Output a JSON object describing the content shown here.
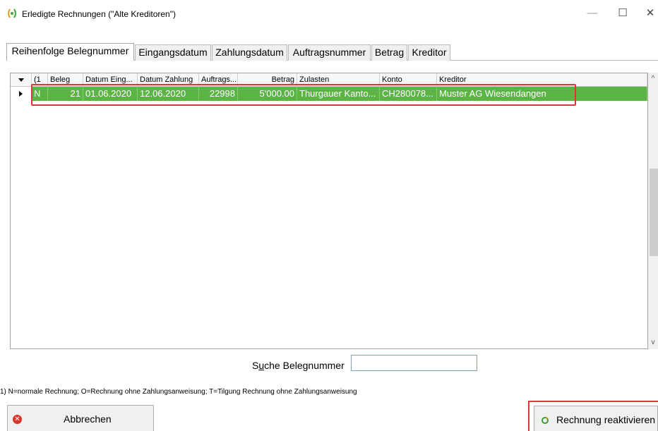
{
  "window": {
    "title": "Erledigte Rechnungen (\"Alte Kreditoren\")",
    "min_symbol": "—",
    "max_symbol": "☐",
    "close_symbol": "✕"
  },
  "tabs": [
    {
      "label": "Reihenfolge Belegnummer",
      "active": true
    },
    {
      "label": "Eingangsdatum",
      "active": false
    },
    {
      "label": "Zahlungsdatum",
      "active": false
    },
    {
      "label": "Auftragsnummer",
      "active": false
    },
    {
      "label": "Betrag",
      "active": false
    },
    {
      "label": "Kreditor",
      "active": false
    }
  ],
  "grid": {
    "columns": {
      "type": "(1",
      "beleg": "Beleg",
      "datum_eing": "Datum Eing...",
      "datum_zahlung": "Datum Zahlung",
      "auftrags": "Auftrags...",
      "betrag": "Betrag",
      "zulasten": "Zulasten",
      "konto": "Konto",
      "kreditor": "Kreditor"
    },
    "rows": [
      {
        "type": "N",
        "beleg": "21",
        "datum_eing": "01.06.2020",
        "datum_zahlung": "12.06.2020",
        "auftrags": "22998",
        "betrag": "5'000.00",
        "zulasten": "Thurgauer Kanto...",
        "konto": "CH280078...",
        "kreditor": "Muster AG Wiesendangen"
      }
    ]
  },
  "scrollbar": {
    "up": "^",
    "down": "v"
  },
  "search": {
    "label_prefix": "S",
    "label_underlined": "u",
    "label_suffix": "che Belegnummer",
    "value": ""
  },
  "footnote": "1) N=normale Rechnung; O=Rechnung ohne Zahlungsanweisung; T=Tilgung Rechnung ohne Zahlungsanweisung",
  "buttons": {
    "cancel": "Abbrechen",
    "reactivate": "Rechnung reaktivieren"
  },
  "colors": {
    "selection": "#5cb445",
    "highlight": "#e0343b"
  },
  "icons": {
    "app": "leaf-parentheses-icon",
    "cancel": "red-x-circle-icon",
    "reactivate": "refresh-arrow-icon"
  }
}
